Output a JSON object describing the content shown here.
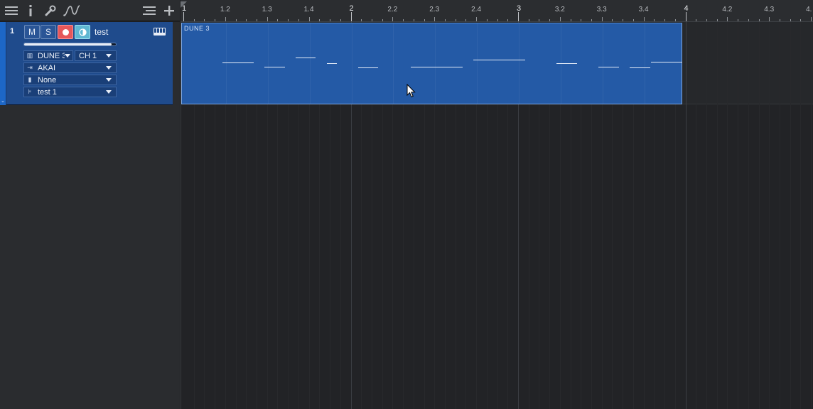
{
  "toolbar": {
    "icons": [
      "menu-icon",
      "info-icon",
      "wrench-icon",
      "automation-curve-icon",
      "list-icon",
      "add-icon"
    ]
  },
  "track": {
    "number": "1",
    "mute_label": "M",
    "solo_label": "S",
    "name": "test",
    "volume_level": 0.95,
    "instrument": "DUNE 3",
    "channel": "CH 1",
    "input": "AKAI",
    "output": "None",
    "pattern": "test 1",
    "color": "#1f4b8c"
  },
  "ruler": {
    "bars": [
      "1",
      "2",
      "3",
      "4"
    ],
    "beats": [
      "1.2",
      "1.3",
      "1.4",
      "2.2",
      "2.3",
      "2.4",
      "3.2",
      "3.3",
      "3.4",
      "4.2",
      "4.3",
      "4."
    ]
  },
  "event": {
    "title": "DUNE 3",
    "color": "#245aa6"
  }
}
